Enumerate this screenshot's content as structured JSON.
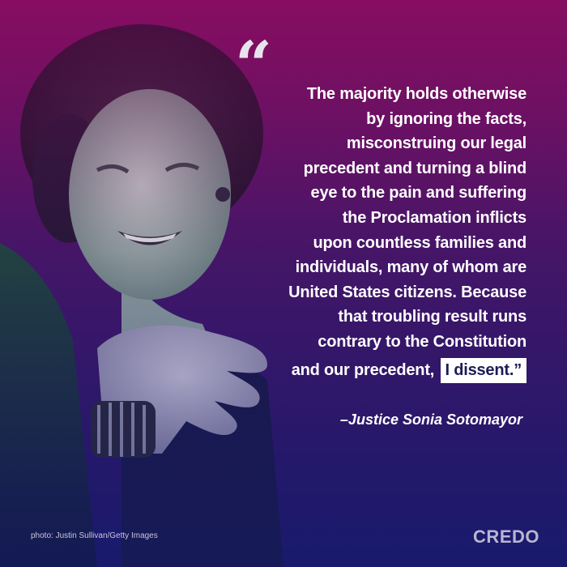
{
  "quote": {
    "lines": [
      "The majority holds otherwise",
      "by ignoring the facts,",
      "misconstruing our legal",
      "precedent and turning a blind",
      "eye to the pain and suffering",
      "the Proclamation inflicts",
      "upon countless families and",
      "individuals, many of whom are",
      "United States citizens. Because",
      "that troubling result runs",
      "contrary to the Constitution"
    ],
    "last_line_lead": "and our precedent,",
    "highlight": "I dissent.”"
  },
  "attribution": "–Justice Sonia Sotomayor",
  "photo_credit": "photo: Justin Sullivan/Getty Images",
  "brand": "CREDO",
  "colors": {
    "top": "#8a1062",
    "mid": "#4a1566",
    "bottom": "#1c1a6a",
    "highlight_bg": "#ffffff",
    "highlight_text": "#1d1c56"
  }
}
